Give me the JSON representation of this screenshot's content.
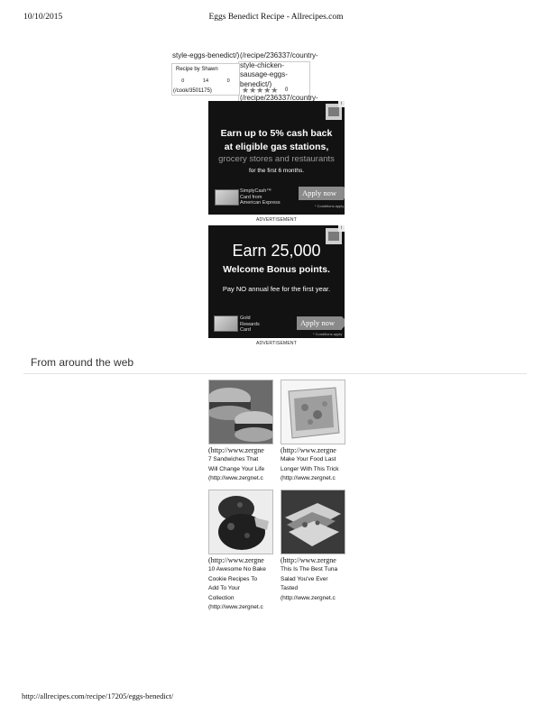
{
  "print": {
    "date": "10/10/2015",
    "title": "Eggs Benedict Recipe - Allrecipes.com",
    "footer_url": "http://allrecipes.com/recipe/17205/eggs-benedict/"
  },
  "fragment": {
    "left_link": "style-eggs-benedict/)",
    "right_link_lines": [
      "(/recipe/236337/country-",
      "style-chicken-",
      "sausage-eggs-",
      "benedict/)"
    ],
    "card_by": "Recipe by Shawn",
    "card_stats": [
      "0",
      "14",
      "0"
    ],
    "cook_link": "(/cook/3501175)",
    "stars": "★★★★★",
    "rating_count": "0",
    "bottom_link": "(/recipe/236337/country-"
  },
  "ad1": {
    "headline_1": "Earn up to 5% cash back",
    "headline_2": "at eligible gas stations,",
    "headline_3": "grocery stores and restaurants",
    "subline": "for the first 6 months.",
    "card_label": [
      "SimplyCash™",
      "Card from",
      "American Express"
    ],
    "button": "Apply now",
    "conditions": "* Conditions apply",
    "caption": "ADVERTISEMENT"
  },
  "ad2": {
    "headline_1": "Earn 25,000",
    "headline_2": "Welcome Bonus points.",
    "subline": "Pay NO annual fee for the first year.",
    "card_label": [
      "Gold",
      "Rewards",
      "Card"
    ],
    "button": "Apply now",
    "conditions": "* Conditions apply",
    "caption": "ADVERTISEMENT"
  },
  "web": {
    "heading": "From around the web",
    "tiles": [
      {
        "link": "(http://www.zergne",
        "title": [
          "7 Sandwiches That",
          "Will Change Your Life"
        ],
        "url": "(http://www.zergnet.c",
        "icon": "sandwich-image"
      },
      {
        "link": "(http://www.zergne",
        "title": [
          "Make Your Food Last",
          "Longer With This Trick"
        ],
        "url": "(http://www.zergnet.c",
        "icon": "food-bag-image"
      },
      {
        "link": "(http://www.zergne",
        "title": [
          "10 Awesome No Bake",
          "Cookie Recipes To",
          "Add To Your",
          "Collection"
        ],
        "url": "(http://www.zergnet.c",
        "icon": "cookie-image"
      },
      {
        "link": "(http://www.zergne",
        "title": [
          "This Is The Best Tuna",
          "Salad You've Ever",
          "Tasted"
        ],
        "url": "(http://www.zergnet.c",
        "icon": "tuna-sandwich-image"
      }
    ]
  }
}
